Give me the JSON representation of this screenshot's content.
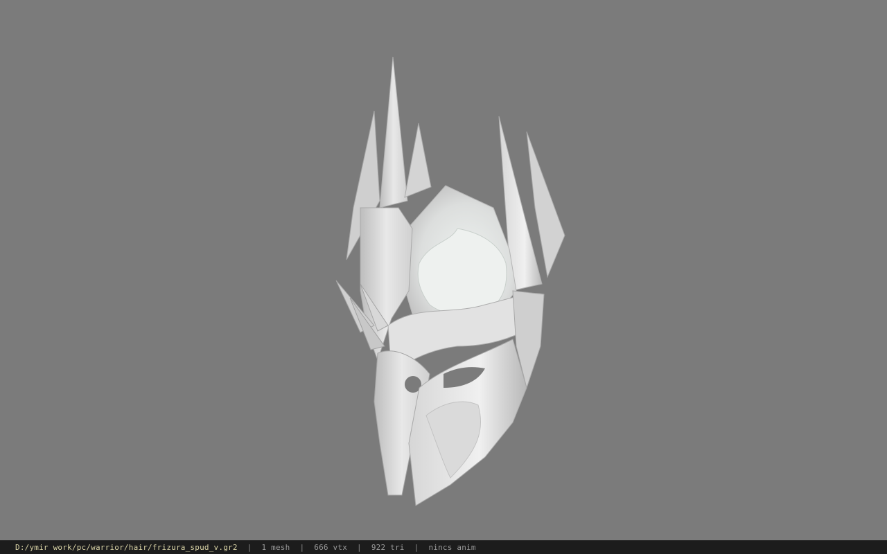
{
  "viewer": {
    "background_color": "#7b7b7b",
    "model_color": "#e4e4e4"
  },
  "status_bar": {
    "file_path": "D:/ymir work/pc/warrior/hair/frizura_spud_v.gr2",
    "separator": "|",
    "mesh_count": "1 mesh",
    "vertex_count": "666 vtx",
    "triangle_count": "922 tri",
    "anim_status": "nincs anim"
  }
}
